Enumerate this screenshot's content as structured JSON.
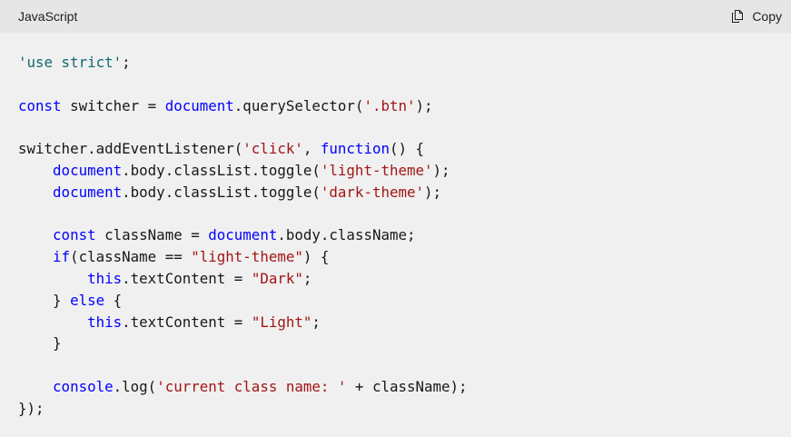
{
  "header": {
    "language": "JavaScript",
    "copy_label": "Copy"
  },
  "icons": {
    "copy": "copy-icon"
  },
  "colors": {
    "background": "#f0f0f0",
    "header_background": "#e6e6e6",
    "keyword": "#0101fd",
    "string": "#a31515",
    "directive": "#0f6a72",
    "text": "#171717"
  },
  "code": {
    "lines": [
      [
        {
          "t": "'use strict'",
          "c": "teal"
        },
        {
          "t": ";",
          "c": "plain"
        }
      ],
      [],
      [
        {
          "t": "const",
          "c": "kw"
        },
        {
          "t": " switcher = ",
          "c": "plain"
        },
        {
          "t": "document",
          "c": "kw"
        },
        {
          "t": ".querySelector(",
          "c": "plain"
        },
        {
          "t": "'.btn'",
          "c": "str"
        },
        {
          "t": ");",
          "c": "plain"
        }
      ],
      [],
      [
        {
          "t": "switcher.addEventListener(",
          "c": "plain"
        },
        {
          "t": "'click'",
          "c": "str"
        },
        {
          "t": ", ",
          "c": "plain"
        },
        {
          "t": "function",
          "c": "kw"
        },
        {
          "t": "() {",
          "c": "plain"
        }
      ],
      [
        {
          "t": "    ",
          "c": "plain"
        },
        {
          "t": "document",
          "c": "kw"
        },
        {
          "t": ".body.classList.toggle(",
          "c": "plain"
        },
        {
          "t": "'light-theme'",
          "c": "str"
        },
        {
          "t": ");",
          "c": "plain"
        }
      ],
      [
        {
          "t": "    ",
          "c": "plain"
        },
        {
          "t": "document",
          "c": "kw"
        },
        {
          "t": ".body.classList.toggle(",
          "c": "plain"
        },
        {
          "t": "'dark-theme'",
          "c": "str"
        },
        {
          "t": ");",
          "c": "plain"
        }
      ],
      [],
      [
        {
          "t": "    ",
          "c": "plain"
        },
        {
          "t": "const",
          "c": "kw"
        },
        {
          "t": " className = ",
          "c": "plain"
        },
        {
          "t": "document",
          "c": "kw"
        },
        {
          "t": ".body.className;",
          "c": "plain"
        }
      ],
      [
        {
          "t": "    ",
          "c": "plain"
        },
        {
          "t": "if",
          "c": "kw"
        },
        {
          "t": "(className == ",
          "c": "plain"
        },
        {
          "t": "\"light-theme\"",
          "c": "str"
        },
        {
          "t": ") {",
          "c": "plain"
        }
      ],
      [
        {
          "t": "        ",
          "c": "plain"
        },
        {
          "t": "this",
          "c": "kw"
        },
        {
          "t": ".textContent = ",
          "c": "plain"
        },
        {
          "t": "\"Dark\"",
          "c": "str"
        },
        {
          "t": ";",
          "c": "plain"
        }
      ],
      [
        {
          "t": "    } ",
          "c": "plain"
        },
        {
          "t": "else",
          "c": "kw"
        },
        {
          "t": " {",
          "c": "plain"
        }
      ],
      [
        {
          "t": "        ",
          "c": "plain"
        },
        {
          "t": "this",
          "c": "kw"
        },
        {
          "t": ".textContent = ",
          "c": "plain"
        },
        {
          "t": "\"Light\"",
          "c": "str"
        },
        {
          "t": ";",
          "c": "plain"
        }
      ],
      [
        {
          "t": "    }",
          "c": "plain"
        }
      ],
      [],
      [
        {
          "t": "    ",
          "c": "plain"
        },
        {
          "t": "console",
          "c": "kw"
        },
        {
          "t": ".log(",
          "c": "plain"
        },
        {
          "t": "'current class name: '",
          "c": "str"
        },
        {
          "t": " + className);",
          "c": "plain"
        }
      ],
      [
        {
          "t": "});",
          "c": "plain"
        }
      ]
    ]
  }
}
